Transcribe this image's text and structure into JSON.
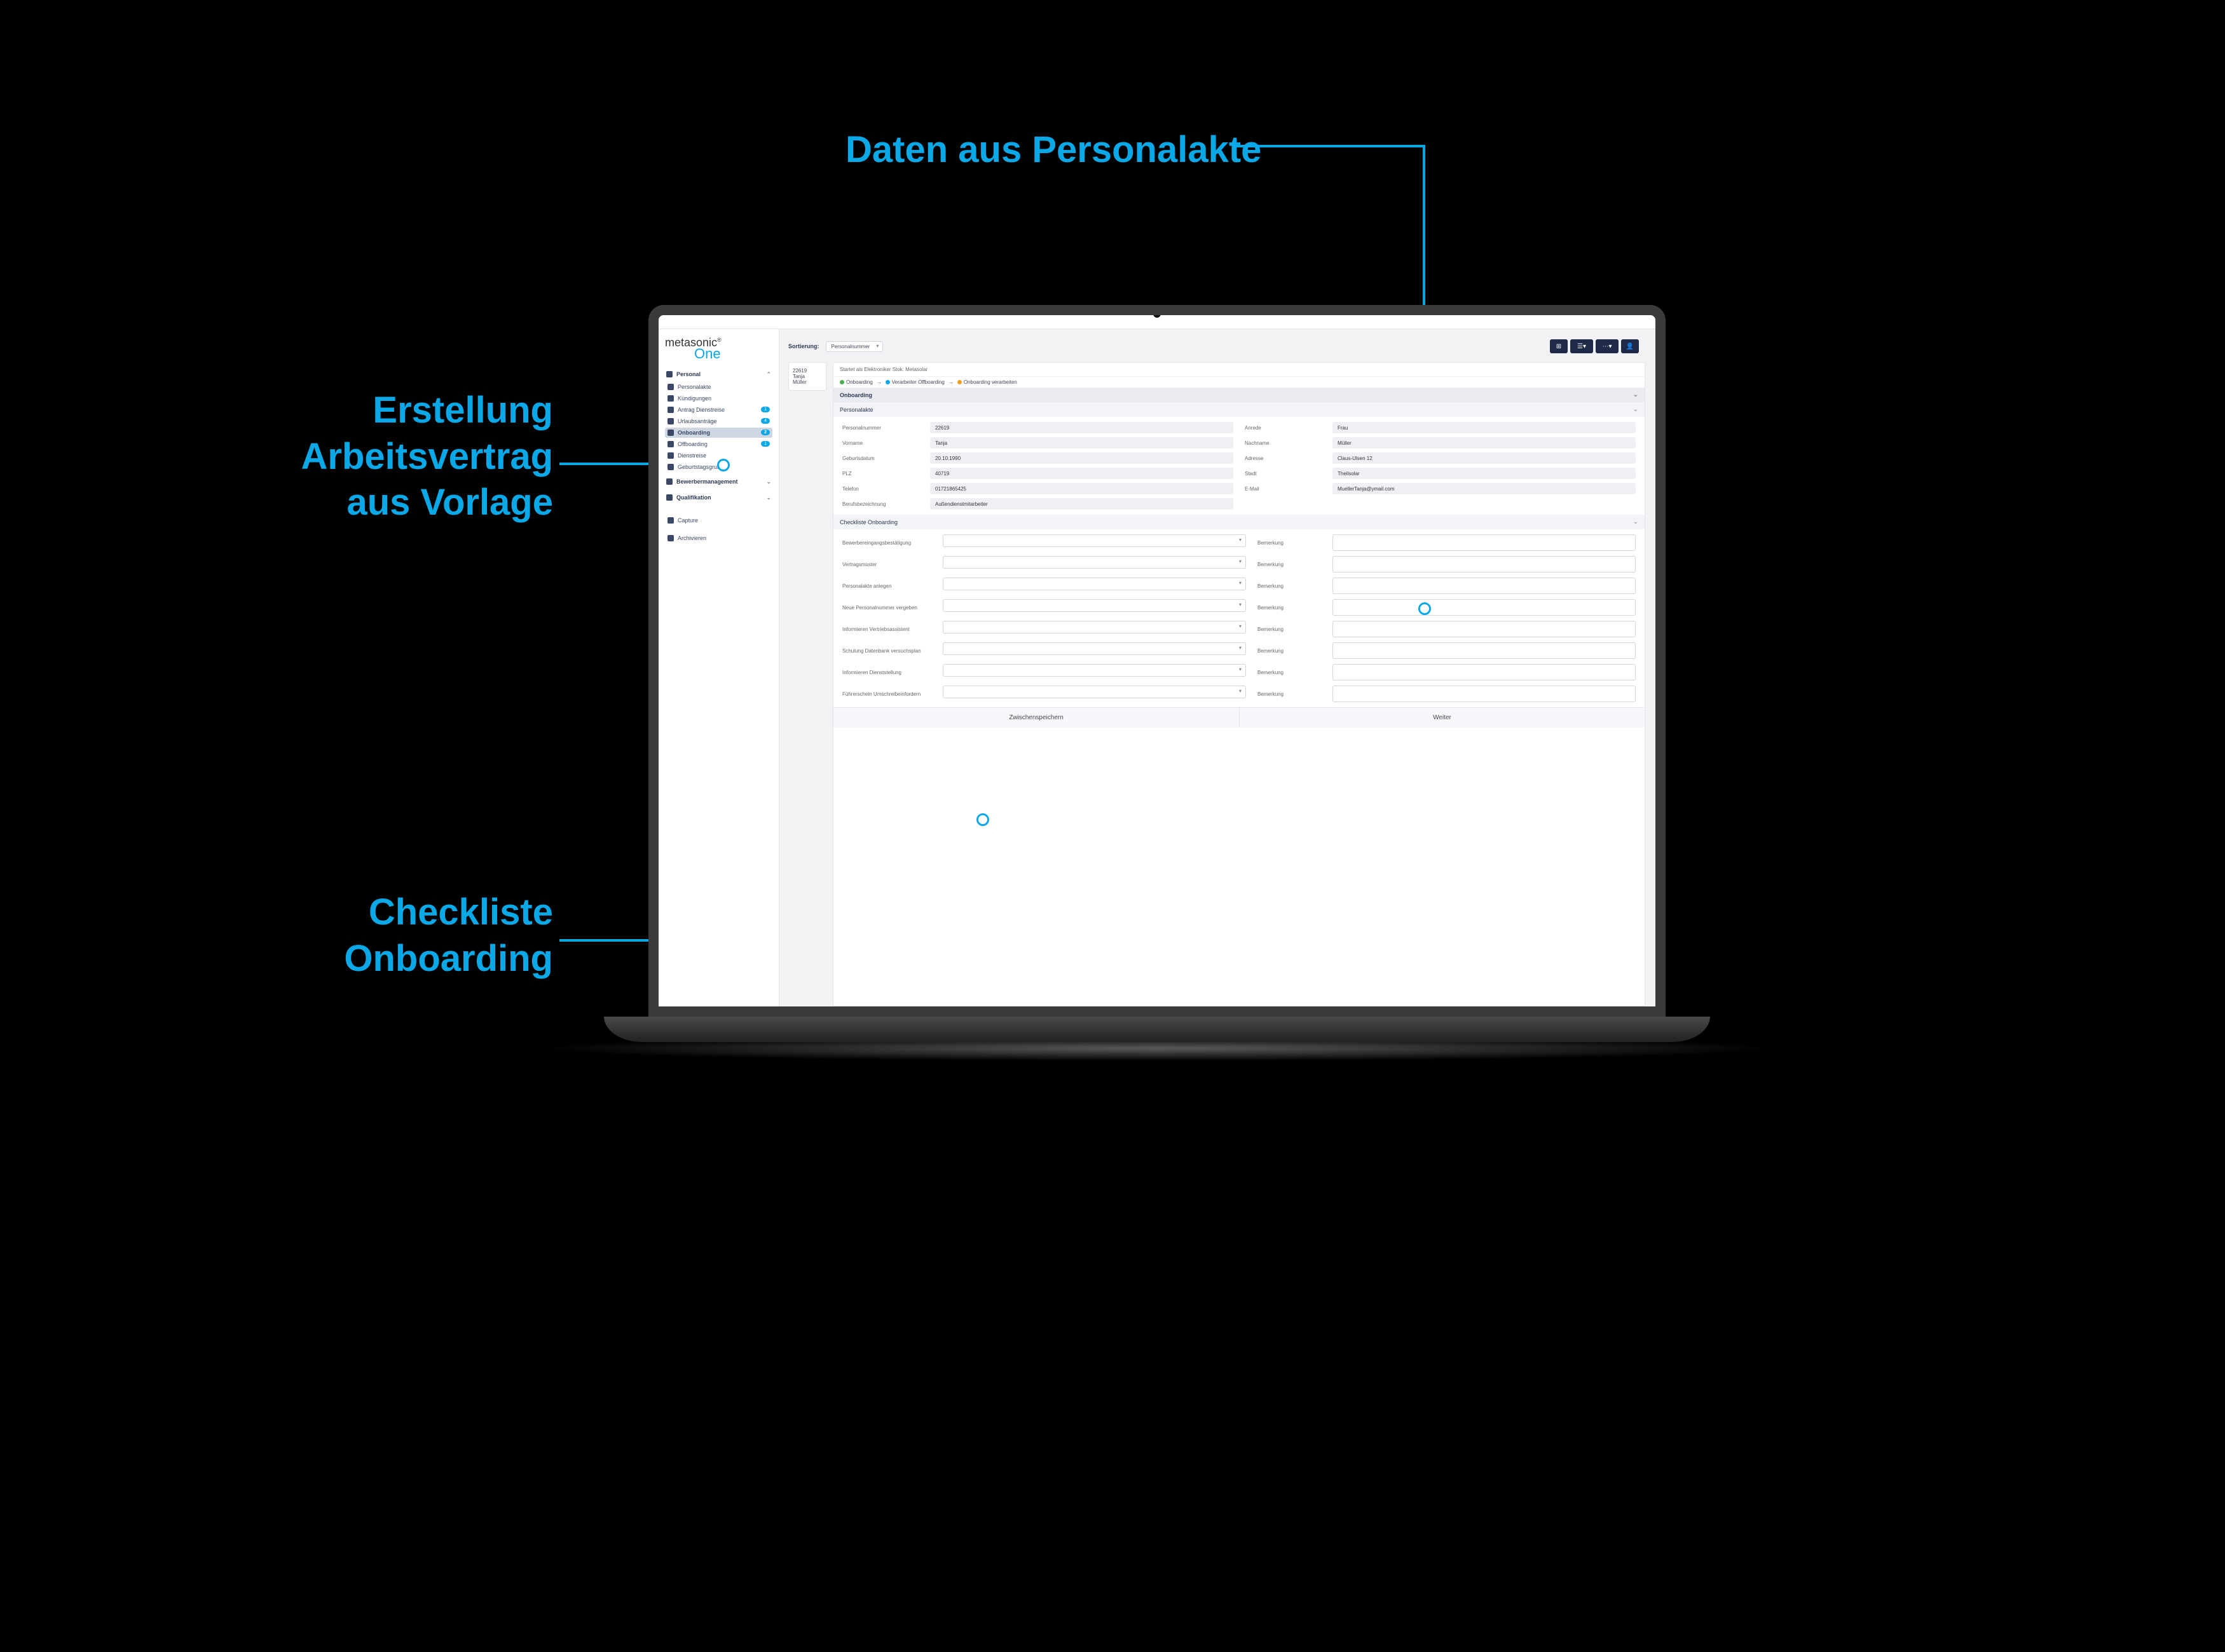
{
  "annotations": {
    "top": "Daten aus Personalakte",
    "left_l1": "Erstellung",
    "left_l2": "Arbeitsvertrag",
    "left_l3": "aus Vorlage",
    "bottom_l1": "Checkliste",
    "bottom_l2": "Onboarding"
  },
  "logo": {
    "brand": "metasonic",
    "sub": "One"
  },
  "sidebar": {
    "groups": [
      {
        "label": "Personal"
      },
      {
        "label": "Bewerbermanagement"
      },
      {
        "label": "Qualifikation"
      }
    ],
    "items": [
      {
        "label": "Personalakte",
        "badge": ""
      },
      {
        "label": "Kündigungen",
        "badge": ""
      },
      {
        "label": "Antrag Dienstreise",
        "badge": "1"
      },
      {
        "label": "Urlaubsanträge",
        "badge": "4"
      },
      {
        "label": "Onboarding",
        "badge": "2",
        "active": true
      },
      {
        "label": "Offboarding",
        "badge": "1"
      },
      {
        "label": "Dienstreise",
        "badge": ""
      },
      {
        "label": "Geburtstagsgruß",
        "badge": ""
      }
    ],
    "extra": [
      {
        "label": "Capture"
      },
      {
        "label": "Archivieren"
      }
    ]
  },
  "header": {
    "sort": "Sortierung:",
    "sort_value": "Personalnummer"
  },
  "infostrip": "Startet als Elektroniker Stok: Metasolar",
  "breadcrumb": {
    "a": "Onboarding",
    "b": "Verarbeiter Offboarding",
    "c": "Onboarding verarbeiten"
  },
  "left_tag": {
    "num": "22619",
    "first": "Tanja",
    "last": "Müller"
  },
  "sections": {
    "main": "Onboarding",
    "akte": "Personalakte",
    "checklist": "Checkliste Onboarding"
  },
  "fields": {
    "personalnummer_l": "Personalnummer",
    "personalnummer_v": "22619",
    "anrede_l": "Anrede",
    "anrede_v": "Frau",
    "vorname_l": "Vorname",
    "vorname_v": "Tanja",
    "nachname_l": "Nachname",
    "nachname_v": "Müller",
    "geburtsdatum_l": "Geburtsdatum",
    "geburtsdatum_v": "20.10.1990",
    "adresse_l": "Adresse",
    "adresse_v": "Claus-Ulsen 12",
    "plz_l": "PLZ",
    "plz_v": "40719",
    "stadt_l": "Stadt",
    "stadt_v": "Theilsolar",
    "telefon_l": "Telefon",
    "telefon_v": "01721865425",
    "email_l": "E-Mail",
    "email_v": "MuellerTanja@ymail.com",
    "beruf_l": "Berufsbezeichnung",
    "beruf_v": "Außendienstmitarbeiter"
  },
  "checklist": {
    "rows": [
      {
        "label": "Bewerbereingangsbestätigung",
        "note_l": "Bemerkung"
      },
      {
        "label": "Vertragsmuster",
        "note_l": "Bemerkung"
      },
      {
        "label": "Personalakte anlegen",
        "note_l": "Bemerkung"
      },
      {
        "label": "Neue Personalnummer vergeben",
        "note_l": "Bemerkung"
      },
      {
        "label": "Informieren Vertriebsassistent",
        "note_l": "Bemerkung"
      },
      {
        "label": "Schulung Datenbank versuchsplan",
        "note_l": "Bemerkung"
      },
      {
        "label": "Informieren Dienststellung",
        "note_l": "Bemerkung"
      },
      {
        "label": "Führerschein Umschreibeinfordern",
        "note_l": "Bemerkung"
      }
    ]
  },
  "actions": {
    "save": "Zwischenspeichern",
    "next": "Weiter"
  }
}
